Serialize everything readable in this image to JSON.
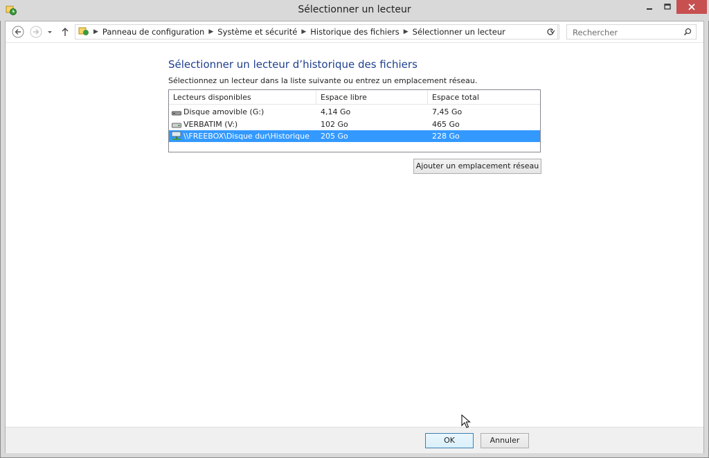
{
  "window": {
    "title": "Sélectionner un lecteur"
  },
  "nav": {
    "breadcrumbs": [
      "Panneau de configuration",
      "Système et sécurité",
      "Historique des fichiers",
      "Sélectionner un lecteur"
    ],
    "search_placeholder": "Rechercher"
  },
  "main": {
    "heading": "Sélectionner un lecteur d’historique des fichiers",
    "subtext": "Sélectionnez un lecteur dans la liste suivante ou entrez un emplacement réseau.",
    "columns": [
      "Lecteurs disponibles",
      "Espace libre",
      "Espace total"
    ],
    "rows": [
      {
        "name": "Disque amovible (G:)",
        "free": "4,14 Go",
        "total": "7,45 Go",
        "icon": "removable-drive-icon"
      },
      {
        "name": "VERBATIM (V:)",
        "free": "102 Go",
        "total": "465 Go",
        "icon": "hard-drive-icon"
      },
      {
        "name": "\\\\FREEBOX\\Disque dur\\Historique",
        "free": "205 Go",
        "total": "228 Go",
        "icon": "network-drive-icon",
        "selected": true
      }
    ],
    "add_network_label": "Ajouter un emplacement réseau"
  },
  "footer": {
    "ok_label": "OK",
    "cancel_label": "Annuler"
  },
  "colors": {
    "heading": "#1e3e8c",
    "selection": "#3399ff",
    "close_button": "#c75050"
  }
}
